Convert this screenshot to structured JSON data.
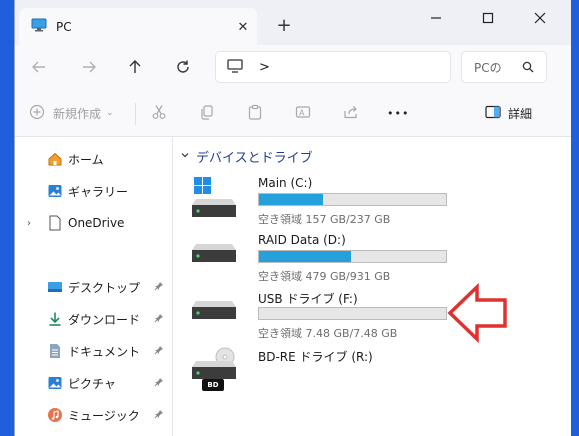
{
  "tab": {
    "title": "PC",
    "close": "✕",
    "new_tab": "+"
  },
  "window_controls": {
    "minimize": "—",
    "maximize": "☐",
    "close": "✕"
  },
  "address": {
    "chevron": ">"
  },
  "search": {
    "placeholder_text": "PCの"
  },
  "commands": {
    "new_label": "新規作成",
    "more": "•••",
    "details_label": "詳細"
  },
  "nav": {
    "items": [
      {
        "label": "ホーム",
        "icon": "home-icon"
      },
      {
        "label": "ギャラリー",
        "icon": "gallery-icon"
      },
      {
        "label": "OneDrive",
        "icon": "onedrive-icon"
      },
      {
        "label": "デスクトップ",
        "icon": "desktop-folder-icon"
      },
      {
        "label": "ダウンロード",
        "icon": "download-icon"
      },
      {
        "label": "ドキュメント",
        "icon": "documents-icon"
      },
      {
        "label": "ピクチャ",
        "icon": "pictures-icon"
      },
      {
        "label": "ミュージック",
        "icon": "music-icon"
      }
    ]
  },
  "group": {
    "title": "デバイスとドライブ"
  },
  "drives": [
    {
      "name": "Main (C:)",
      "free_text": "空き領域 157 GB/237 GB",
      "used_fraction": 0.34,
      "icon": "windows-drive-icon"
    },
    {
      "name": "RAID Data (D:)",
      "free_text": "空き領域 479 GB/931 GB",
      "used_fraction": 0.49,
      "icon": "hard-drive-icon"
    },
    {
      "name": "USB ドライブ (F:)",
      "free_text": "空き領域 7.48 GB/7.48 GB",
      "used_fraction": 0.0,
      "icon": "usb-drive-icon"
    },
    {
      "name": "BD-RE ドライブ (R:)",
      "badge": "BD",
      "icon": "optical-drive-icon"
    }
  ],
  "colors": {
    "accent": "#26a0da",
    "annotation_arrow": "#e03030",
    "background": "#1f5fdc"
  }
}
